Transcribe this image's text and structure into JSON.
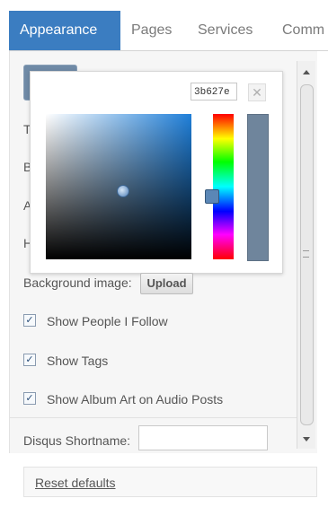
{
  "tabs": [
    {
      "label": "Appearance",
      "active": true
    },
    {
      "label": "Pages",
      "active": false
    },
    {
      "label": "Services",
      "active": false
    },
    {
      "label": "Comm",
      "active": false
    }
  ],
  "colors": {
    "accent": "#3b7dc1",
    "selected_color": "#6f859c"
  },
  "color_picker": {
    "hex_value": "3b627e",
    "close_icon": "close-icon",
    "close_glyph": "✕"
  },
  "behind_popup_labels": [
    "T",
    "B",
    "A",
    "H"
  ],
  "background_image": {
    "label": "Background image:",
    "button_label": "Upload"
  },
  "options": [
    {
      "label": "Show People I Follow",
      "checked": true
    },
    {
      "label": "Show Tags",
      "checked": true
    },
    {
      "label": "Show Album Art on Audio Posts",
      "checked": true
    }
  ],
  "disqus": {
    "label": "Disqus Shortname:",
    "value": ""
  },
  "footer": {
    "reset_label": "Reset defaults"
  },
  "checkmark": "✓"
}
